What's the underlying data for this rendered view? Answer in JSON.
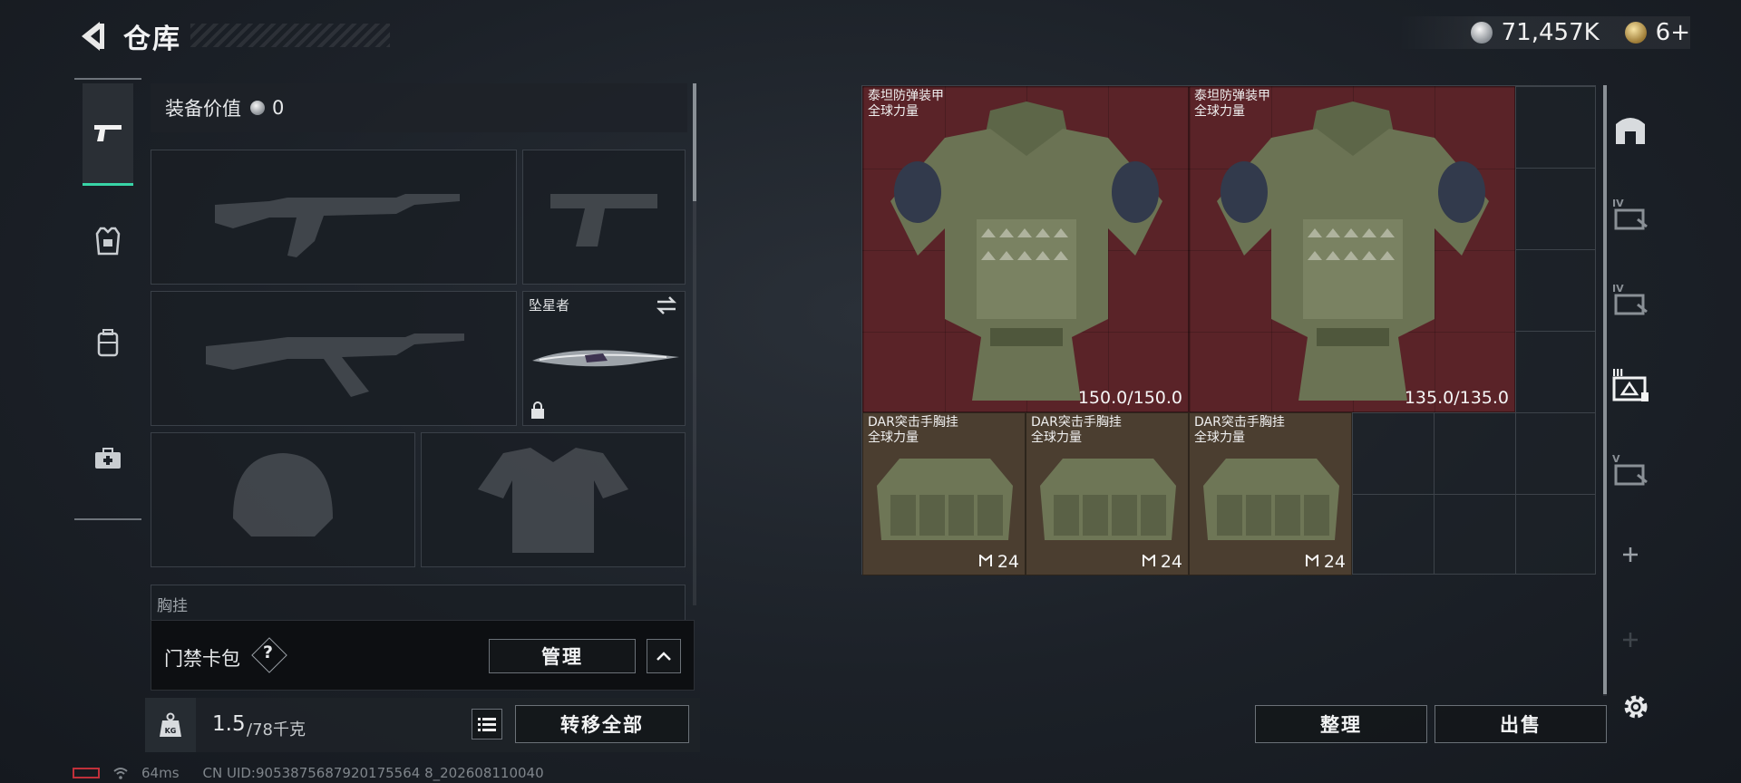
{
  "header": {
    "title": "仓库",
    "back_icon": "back-arrow-icon"
  },
  "currency": {
    "silver": "71,457K",
    "gold": "6+"
  },
  "categories": [
    {
      "name": "firearm",
      "icon": "pistol-icon",
      "active": true
    },
    {
      "name": "armor",
      "icon": "armor-vest-icon",
      "active": false
    },
    {
      "name": "backpack",
      "icon": "backpack-icon",
      "active": false
    },
    {
      "name": "medkit",
      "icon": "medkit-icon",
      "active": false
    }
  ],
  "equipment": {
    "value_label": "装备价值",
    "value": "0",
    "melee": {
      "name": "坠星者"
    },
    "chest_rig_label": "胸挂"
  },
  "card_pack": {
    "label": "门禁卡包",
    "help": "?",
    "manage_label": "管理"
  },
  "bottom": {
    "weight": "1.5",
    "weight_max": "/78千克",
    "transfer_label": "转移全部",
    "kg_badge": "KG"
  },
  "stash": {
    "items": [
      {
        "name": "泰坦防弹装甲",
        "sub": "全球力量",
        "durability": "150.0/150.0"
      },
      {
        "name": "泰坦防弹装甲",
        "sub": "全球力量",
        "durability": "135.0/135.0"
      },
      {
        "name": "DAR突击手胸挂",
        "sub": "全球力量",
        "capacity": "24"
      },
      {
        "name": "DAR突击手胸挂",
        "sub": "全球力量",
        "capacity": "24"
      },
      {
        "name": "DAR突击手胸挂",
        "sub": "全球力量",
        "capacity": "24"
      }
    ],
    "organize_label": "整理",
    "sell_label": "出售"
  },
  "right_tabs": [
    {
      "icon": "stash-icon"
    },
    {
      "icon": "container-iv-icon",
      "label": "IV"
    },
    {
      "icon": "container-iv-icon",
      "label": "IV"
    },
    {
      "icon": "container-iii-icon",
      "label": "III",
      "active": true
    },
    {
      "icon": "container-v-icon",
      "label": "V"
    },
    {
      "icon": "add-icon"
    },
    {
      "icon": "add-icon"
    }
  ],
  "status": {
    "ping": "64ms",
    "uid": "CN UID:9053875687920175564 8_202608110040"
  },
  "colors": {
    "accent": "#38d4a6",
    "red_bg": "#5a2328",
    "brown_bg": "#4b3e30"
  }
}
